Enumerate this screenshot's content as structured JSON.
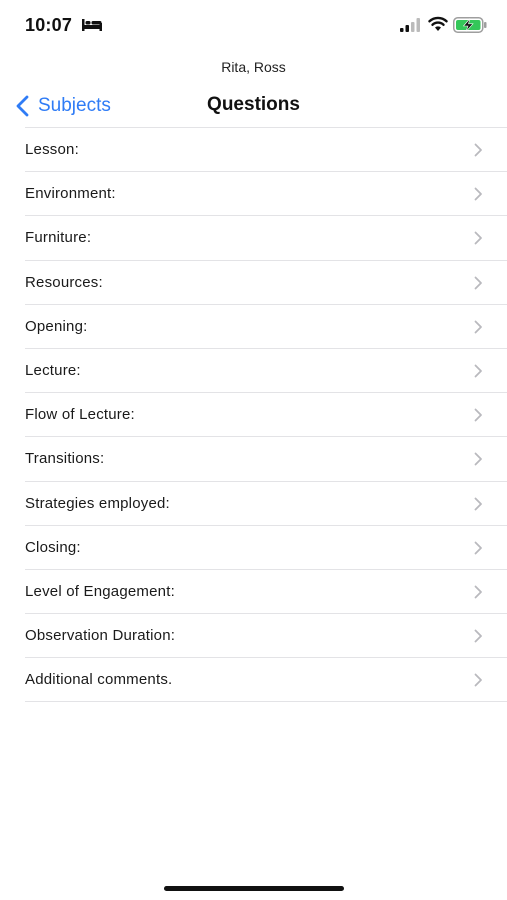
{
  "status_bar": {
    "time": "10:07",
    "icons": [
      "bed-icon",
      "signal-icon",
      "wifi-icon",
      "battery-charging-icon"
    ],
    "battery_color": "#34c759"
  },
  "nav": {
    "subtitle": "Rita, Ross",
    "back_label": "Subjects",
    "title": "Questions",
    "accent_color": "#2f7cf6"
  },
  "questions": [
    {
      "label": "Lesson:"
    },
    {
      "label": "Environment:"
    },
    {
      "label": "Furniture:"
    },
    {
      "label": "Resources:"
    },
    {
      "label": "Opening:"
    },
    {
      "label": "Lecture:"
    },
    {
      "label": "Flow of Lecture:"
    },
    {
      "label": "Transitions:"
    },
    {
      "label": "Strategies employed:"
    },
    {
      "label": "Closing:"
    },
    {
      "label": "Level of Engagement:"
    },
    {
      "label": "Observation Duration:"
    },
    {
      "label": "Additional comments."
    }
  ]
}
